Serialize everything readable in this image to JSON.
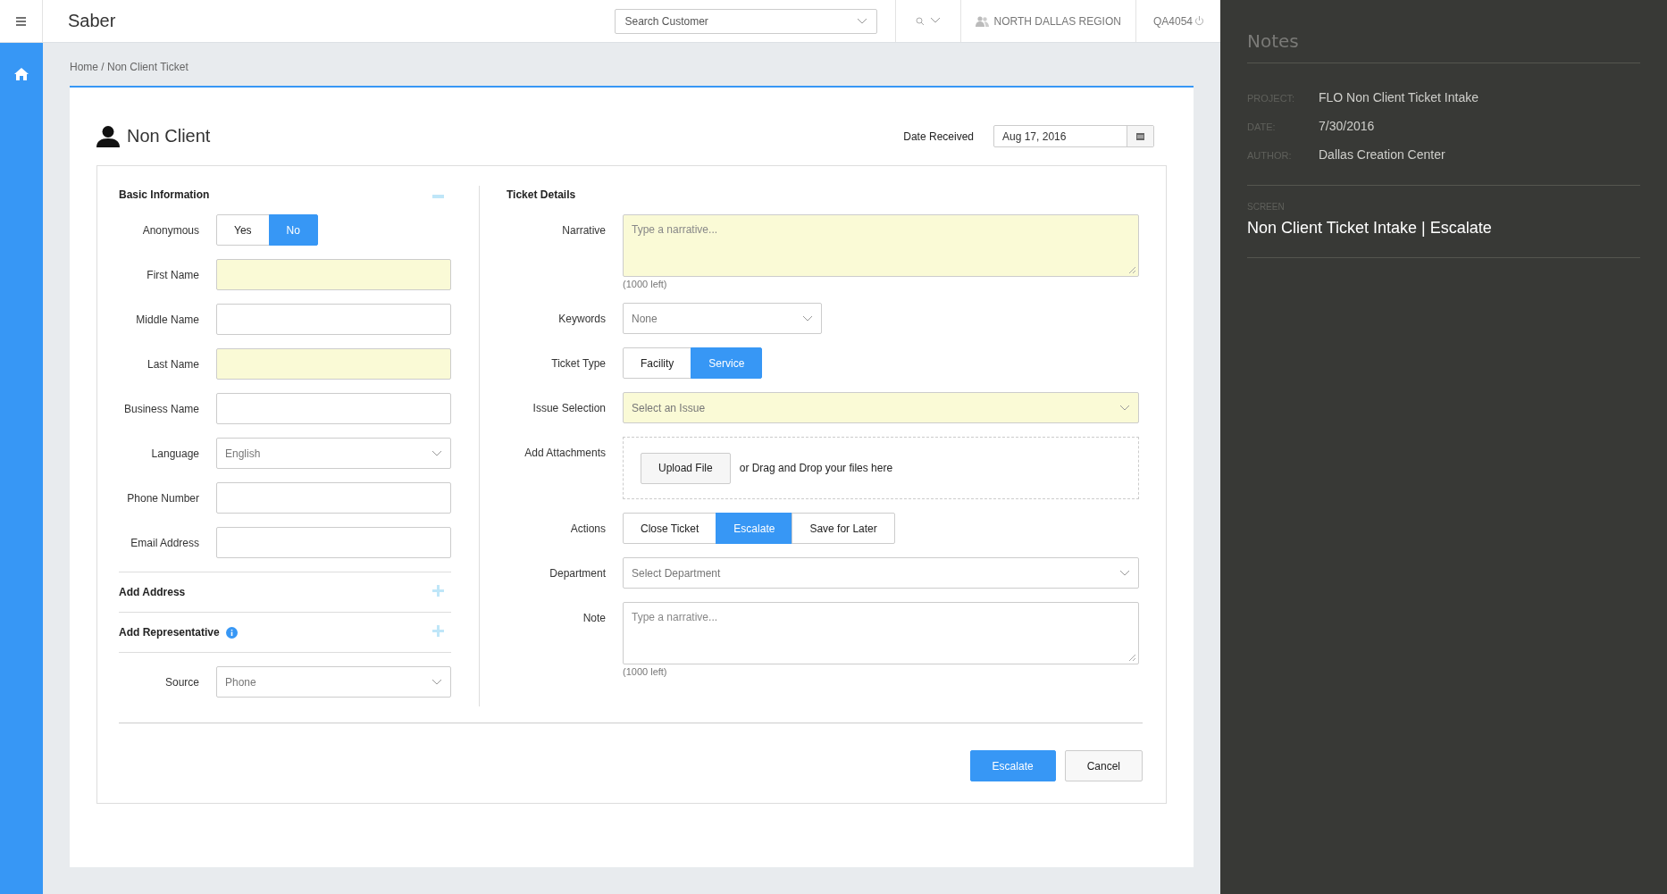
{
  "app": {
    "title": "Saber",
    "search": {
      "placeholder": "Search Customer"
    },
    "region": "NORTH DALLAS REGION",
    "user": "QA4054"
  },
  "breadcrumb": "Home / Non Client Ticket",
  "page_title": "Non Client",
  "date_received": {
    "label": "Date Received",
    "value": "Aug 17, 2016"
  },
  "basic_information": {
    "title": "Basic Information",
    "expanded": true,
    "fields": [
      {
        "label": "Anonymous",
        "kind": "toggle",
        "options": [
          {
            "label": "Yes",
            "selected": false
          },
          {
            "label": "No",
            "selected": true
          }
        ]
      },
      {
        "label": "First Name",
        "kind": "text",
        "required": true
      },
      {
        "label": "Middle Name",
        "kind": "text",
        "required": false
      },
      {
        "label": "Last Name",
        "kind": "text",
        "required": true
      },
      {
        "label": "Business Name",
        "kind": "text",
        "required": false
      },
      {
        "label": "Language",
        "kind": "select",
        "value": "English"
      },
      {
        "label": "Phone Number",
        "kind": "text",
        "required": false
      },
      {
        "label": "Email Address",
        "kind": "text",
        "required": false
      }
    ]
  },
  "sections": [
    {
      "title": "Add Address",
      "info": false,
      "expanded": false
    },
    {
      "title": "Add Representative",
      "info": true,
      "expanded": false
    }
  ],
  "source": {
    "label": "Source",
    "kind": "select",
    "value": "Phone"
  },
  "ticket_details": {
    "title": "Ticket Details",
    "fields": [
      {
        "label": "Narrative",
        "kind": "textarea",
        "placeholder": "Type a narrative...",
        "counter": "(1000 left)",
        "required": true
      },
      {
        "label": "Keywords",
        "kind": "select",
        "value": "None"
      },
      {
        "label": "Ticket Type",
        "kind": "toggle",
        "options": [
          {
            "label": "Facility",
            "selected": false
          },
          {
            "label": "Service",
            "selected": true
          }
        ]
      },
      {
        "label": "Issue Selection",
        "kind": "select",
        "placeholder": "Select an Issue",
        "required": true
      },
      {
        "label": "Add Attachments",
        "kind": "upload",
        "button": "Upload File",
        "hint": "or Drag and Drop your files here"
      },
      {
        "label": "Actions",
        "kind": "toggle",
        "options": [
          {
            "label": "Close Ticket",
            "selected": false
          },
          {
            "label": "Escalate",
            "selected": true
          },
          {
            "label": "Save for Later",
            "selected": false
          }
        ]
      },
      {
        "label": "Department",
        "kind": "select",
        "placeholder": "Select Department"
      },
      {
        "label": "Note",
        "kind": "textarea",
        "placeholder": "Type a narrative...",
        "counter": "(1000 left)",
        "required": false
      }
    ]
  },
  "buttons": [
    {
      "label": "Escalate",
      "primary": true
    },
    {
      "label": "Cancel",
      "primary": false
    }
  ],
  "notes": {
    "title": "Notes",
    "meta": [
      {
        "label": "PROJECT:",
        "value": "FLO Non Client Ticket Intake"
      },
      {
        "label": "DATE:",
        "value": "7/30/2016"
      },
      {
        "label": "AUTHOR:",
        "value": "Dallas Creation Center"
      }
    ],
    "screen_label": "SCREEN",
    "screen": "Non Client Ticket Intake | Escalate"
  }
}
